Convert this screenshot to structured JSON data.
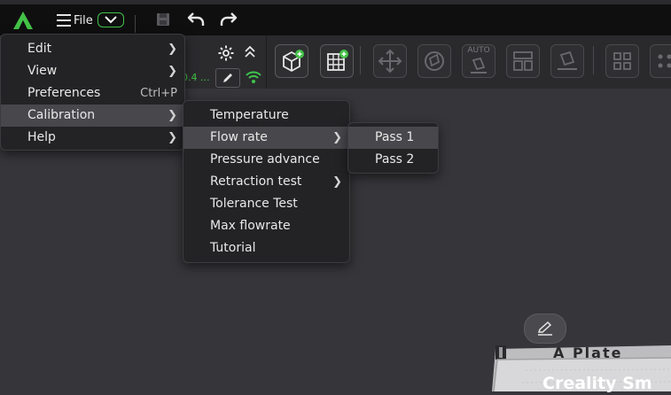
{
  "app": {
    "file_label": "File",
    "nozzle_value": "0.4 ...",
    "accent": "#43c247",
    "wifi_color": "#3cc44a"
  },
  "main_menu": {
    "items": [
      {
        "label": "Edit",
        "shortcut": "",
        "submenu": true
      },
      {
        "label": "View",
        "shortcut": "",
        "submenu": true
      },
      {
        "label": "Preferences",
        "shortcut": "Ctrl+P",
        "submenu": false
      },
      {
        "label": "Calibration",
        "shortcut": "",
        "submenu": true
      },
      {
        "label": "Help",
        "shortcut": "",
        "submenu": true
      }
    ]
  },
  "calibration_menu": {
    "items": [
      {
        "label": "Temperature",
        "submenu": false
      },
      {
        "label": "Flow rate",
        "submenu": true
      },
      {
        "label": "Pressure advance",
        "submenu": false
      },
      {
        "label": "Retraction test",
        "submenu": true
      },
      {
        "label": "Tolerance Test",
        "submenu": false
      },
      {
        "label": "Max flowrate",
        "submenu": false
      },
      {
        "label": "Tutorial",
        "submenu": false
      }
    ]
  },
  "flow_rate_menu": {
    "items": [
      {
        "label": "Pass 1"
      },
      {
        "label": "Pass 2"
      }
    ]
  },
  "toolbar": {
    "auto_label": "AUTO"
  },
  "plate": {
    "name": "A Plate",
    "brand": "Creality Sm"
  }
}
